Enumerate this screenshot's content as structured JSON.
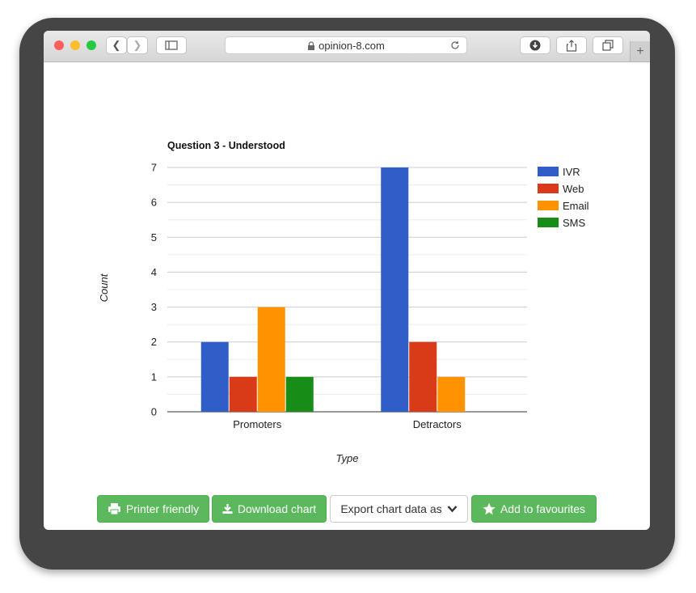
{
  "browser": {
    "url": "opinion-8.com"
  },
  "buttons": {
    "printer": "Printer friendly",
    "download": "Download chart",
    "export": "Export chart data as",
    "favourites": "Add to favourites"
  },
  "colors": {
    "IVR": "#2f5ec8",
    "Web": "#d93a17",
    "Email": "#ff9200",
    "SMS": "#178c17",
    "button_green": "#5cb85c"
  },
  "chart_data": {
    "type": "bar",
    "title": "Question 3 - Understood",
    "xlabel": "Type",
    "ylabel": "Count",
    "categories": [
      "Promoters",
      "Detractors"
    ],
    "series": [
      {
        "name": "IVR",
        "values": [
          2,
          7
        ]
      },
      {
        "name": "Web",
        "values": [
          1,
          2
        ]
      },
      {
        "name": "Email",
        "values": [
          3,
          1
        ]
      },
      {
        "name": "SMS",
        "values": [
          1,
          0
        ]
      }
    ],
    "ylim": [
      0,
      7
    ],
    "yticks": [
      0,
      1,
      2,
      3,
      4,
      5,
      6,
      7
    ],
    "grid": true,
    "legend": "right"
  }
}
